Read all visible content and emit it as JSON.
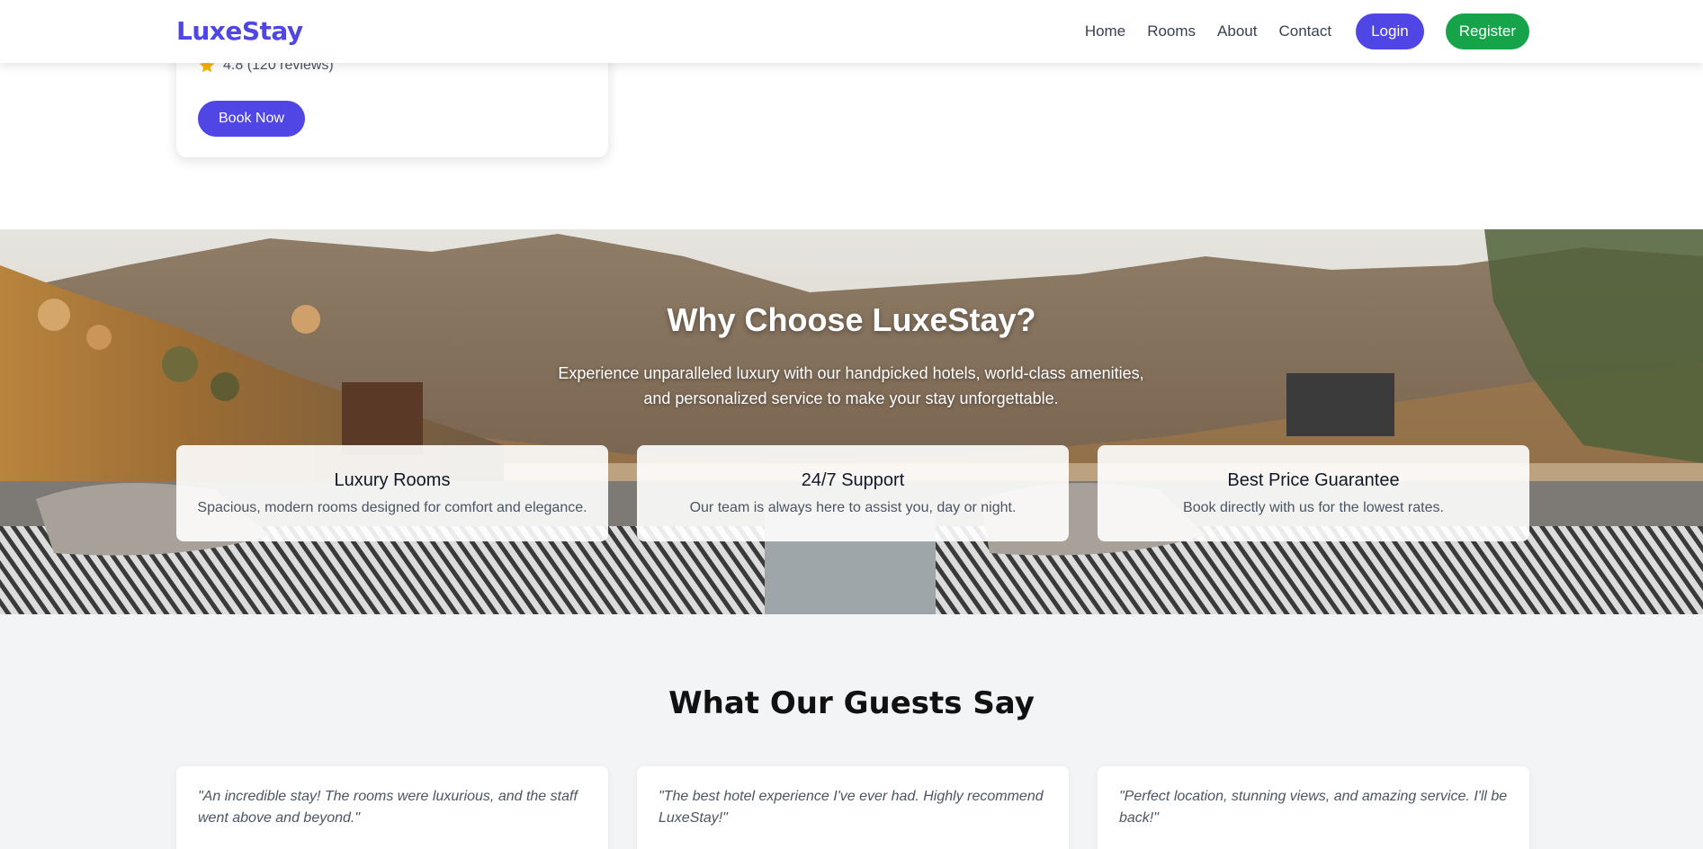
{
  "header": {
    "brand": "LuxeStay",
    "nav": [
      "Home",
      "Rooms",
      "About",
      "Contact"
    ],
    "login_label": "Login",
    "register_label": "Register"
  },
  "room_card": {
    "rating": "4.8 (120 reviews)",
    "book_label": "Book Now"
  },
  "why": {
    "title": "Why Choose LuxeStay?",
    "subtitle": "Experience unparalleled luxury with our handpicked hotels, world-class amenities, and personalized service to make your stay unforgettable.",
    "features": [
      {
        "title": "Luxury Rooms",
        "desc": "Spacious, modern rooms designed for comfort and elegance."
      },
      {
        "title": "24/7 Support",
        "desc": "Our team is always here to assist you, day or night."
      },
      {
        "title": "Best Price Guarantee",
        "desc": "Book directly with us for the lowest rates."
      }
    ]
  },
  "testimonials": {
    "title": "What Our Guests Say",
    "items": [
      "\"An incredible stay! The rooms were luxurious, and the staff went above and beyond.\"",
      "\"The best hotel experience I've ever had. Highly recommend LuxeStay!\"",
      "\"Perfect location, stunning views, and amazing service. I'll be back!\""
    ]
  },
  "colors": {
    "brand": "#4f46e5",
    "register": "#16a34a",
    "star": "#f4b400"
  }
}
